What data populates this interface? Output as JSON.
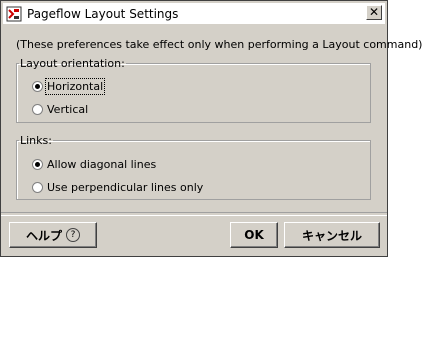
{
  "window": {
    "title": "Pageflow Layout Settings",
    "close_label": "✕"
  },
  "note": "(These preferences take effect only when performing a Layout command)",
  "orientation": {
    "legend": "Layout orientation:",
    "options": [
      "Horizontal",
      "Vertical"
    ],
    "selected": "Horizontal"
  },
  "links": {
    "legend": "Links:",
    "options": [
      "Allow diagonal lines",
      "Use perpendicular lines only"
    ],
    "selected": "Allow diagonal lines"
  },
  "buttons": {
    "help": "ヘルプ",
    "help_icon": "?",
    "ok": "OK",
    "cancel": "キャンセル"
  }
}
